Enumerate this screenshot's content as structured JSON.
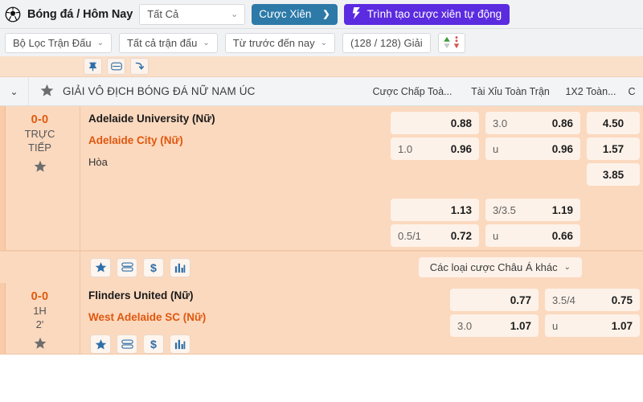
{
  "topbar": {
    "sport_icon": "soccer-ball-icon",
    "breadcrumb": "Bóng đá / Hôm Nay",
    "all_select": {
      "value": "Tất Cả",
      "chevron": "⌄"
    },
    "parlay_button": {
      "label": "Cược Xiên",
      "arrow": "❯"
    },
    "auto_parlay_button": {
      "bolt": "⚡",
      "label": "Trình tạo cược xiên tự động"
    }
  },
  "filterbar": {
    "match_filter": {
      "label": "Bộ Lọc Trận Đấu",
      "chevron": "⌄"
    },
    "all_matches": {
      "label": "Tất cả trận đấu",
      "chevron": "⌄"
    },
    "time_range": {
      "label": "Từ trước đến nay",
      "chevron": "⌄"
    },
    "league_count": "(128 / 128) Giải",
    "sort_toggle": {
      "up_icon": "sort-ascending-icon",
      "down_icon": "sort-descending-icon"
    }
  },
  "iconstrip": {
    "items": [
      {
        "name": "pin-icon",
        "glyph": "pin"
      },
      {
        "name": "layers-icon",
        "glyph": "layers"
      },
      {
        "name": "arrow-icon",
        "glyph": "arrow"
      }
    ]
  },
  "league": {
    "collapse_chevron": "⌄",
    "star_icon": "star-filled-icon",
    "name": "GIẢI VÔ ĐỊCH BÓNG ĐÁ NỮ NAM ÚC",
    "columns": [
      "Cược Chấp Toà...",
      "Tài Xỉu Toàn Trận",
      "1X2 Toàn...",
      "C"
    ]
  },
  "matches": [
    {
      "score": "0-0",
      "status_lines": [
        "TRỰC",
        "TIẾP"
      ],
      "favorite_icon": "star-icon",
      "home_team": "Adelaide University (Nữ)",
      "away_team": "Adelaide City (Nữ)",
      "draw_label": "Hòa",
      "markets": [
        {
          "handicap": [
            {
              "label": "",
              "odds": "0.88"
            },
            {
              "label": "1.0",
              "odds": "0.96"
            }
          ],
          "over_under": [
            {
              "label": "3.0",
              "odds": "0.86"
            },
            {
              "label": "u",
              "odds": "0.96"
            }
          ],
          "one_x_two": [
            "4.50",
            "1.57",
            "3.85"
          ]
        },
        {
          "handicap": [
            {
              "label": "",
              "odds": "1.13"
            },
            {
              "label": "0.5/1",
              "odds": "0.72"
            }
          ],
          "over_under": [
            {
              "label": "3/3.5",
              "odds": "1.19"
            },
            {
              "label": "u",
              "odds": "0.66"
            }
          ],
          "one_x_two": []
        }
      ],
      "footer_icons": [
        "star-icon",
        "stacked-layers-icon",
        "dollar-icon",
        "bar-chart-icon"
      ],
      "more_asian": {
        "label": "Các loại cược Châu Á khác",
        "chevron": "⌄"
      }
    },
    {
      "score": "0-0",
      "status_lines": [
        "1H",
        "2'"
      ],
      "favorite_icon": "star-icon",
      "home_team": "Flinders United (Nữ)",
      "away_team": "West Adelaide SC (Nữ)",
      "draw_label": "",
      "markets": [
        {
          "handicap": [
            {
              "label": "",
              "odds": "0.77"
            },
            {
              "label": "3.0",
              "odds": "1.07"
            }
          ],
          "over_under": [
            {
              "label": "3.5/4",
              "odds": "0.75"
            },
            {
              "label": "u",
              "odds": "1.07"
            }
          ],
          "one_x_two": []
        }
      ],
      "footer_icons": [
        "star-icon",
        "stacked-layers-icon",
        "dollar-icon",
        "bar-chart-icon"
      ],
      "more_asian": null
    }
  ],
  "colors": {
    "accent_blue": "#2d7aa8",
    "accent_purple": "#5b2be0",
    "row_bg": "#fbd9bf",
    "cell_bg": "#fdf2e9",
    "away_team": "#e0570e",
    "score": "#e05a10"
  }
}
